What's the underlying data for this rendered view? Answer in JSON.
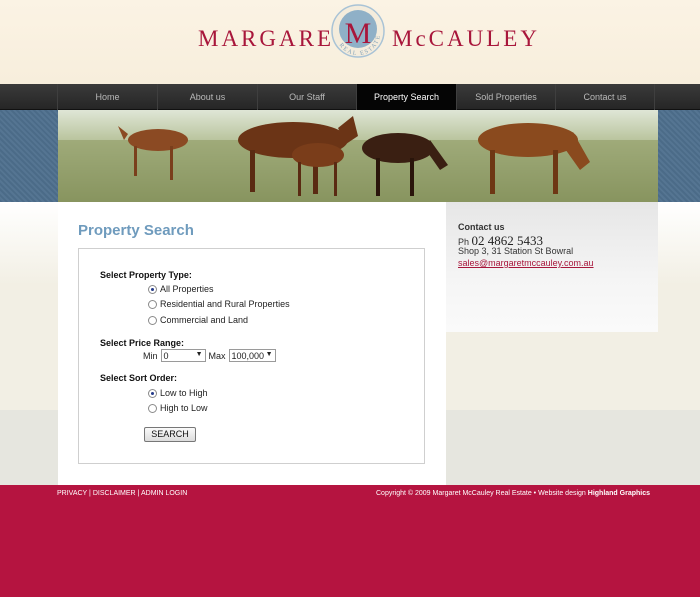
{
  "header": {
    "brand_left": "MARGARET",
    "brand_right": "McCAULEY",
    "logo_letter": "M",
    "logo_ring_text": "REAL ESTATE",
    "brand_color": "#a8163b"
  },
  "nav": {
    "items": [
      {
        "label": "Home"
      },
      {
        "label": "About us"
      },
      {
        "label": "Our Staff"
      },
      {
        "label": "Property Search"
      },
      {
        "label": "Sold Properties"
      },
      {
        "label": "Contact us"
      }
    ],
    "active": "Property Search"
  },
  "main": {
    "title": "Property Search",
    "property_type": {
      "label": "Select Property Type:",
      "options": [
        "All Properties",
        "Residential and Rural Properties",
        "Commercial and Land"
      ],
      "selected": "All Properties"
    },
    "price_range": {
      "label": "Select Price Range:",
      "min_label": "Min",
      "min_value": "0",
      "max_label": "Max",
      "max_value": "100,000"
    },
    "sort_order": {
      "label": "Select Sort Order:",
      "options": [
        "Low to High",
        "High to Low"
      ],
      "selected": "Low to High"
    },
    "search_button": "SEARCH"
  },
  "sidebar": {
    "title": "Contact us",
    "phone_prefix": "Ph",
    "phone": "02 4862 5433",
    "address": "Shop 3, 31 Station St Bowral",
    "email": "sales@margaretmccauley.com.au"
  },
  "footer": {
    "links": [
      "PRIVACY",
      "DISCLAIMER",
      "ADMIN LOGIN"
    ],
    "separator": "|",
    "copyright": "Copyright © 2009 Margaret McCauley Real Estate • Website design",
    "designer": "Highland Graphics"
  }
}
